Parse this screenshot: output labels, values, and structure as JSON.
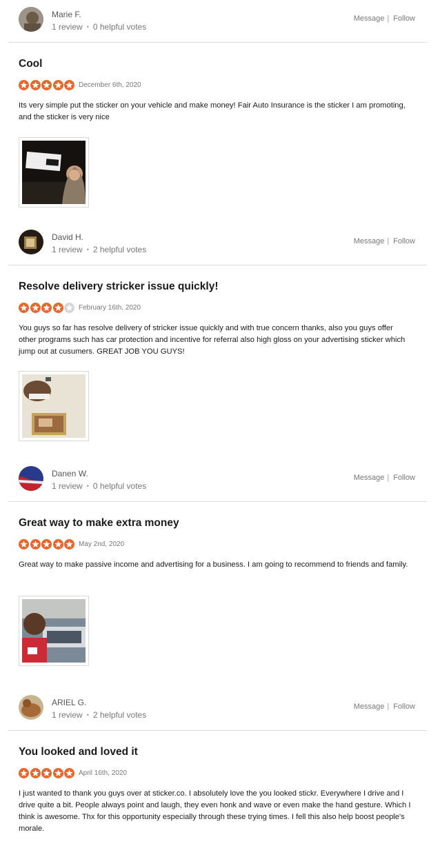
{
  "colors": {
    "star_on": "#e8662a",
    "star_off": "#d6d6d6"
  },
  "reviews": [
    {
      "user": {
        "name": "Marie F.",
        "reviews": "1 review",
        "votes": "0 helpful votes"
      },
      "actions": {
        "message": "Message",
        "separator": "|",
        "follow": "Follow"
      },
      "title": "Cool",
      "rating": 5,
      "date": "December 6th, 2020",
      "text": "Its very simple put the sticker on your vehicle and make money! Fair Auto Insurance is the sticker I am promoting, and the sticker is very nice"
    },
    {
      "user": {
        "name": "David H.",
        "reviews": "1 review",
        "votes": "2 helpful votes"
      },
      "actions": {
        "message": "Message",
        "separator": "|",
        "follow": "Follow"
      },
      "title": "Resolve delivery stricker issue quickly!",
      "rating": 4,
      "date": "February 16th, 2020",
      "text": "You guys so far has resolve delivery of stricker issue quickly and with true concern thanks, also you guys offer other programs such has car protection and incentive for referral also high gloss on your advertising sticker which jump out at cusumers. GREAT JOB YOU GUYS!"
    },
    {
      "user": {
        "name": "Danen W.",
        "reviews": "1 review",
        "votes": "0 helpful votes"
      },
      "actions": {
        "message": "Message",
        "separator": "|",
        "follow": "Follow"
      },
      "title": "Great way to make extra money",
      "rating": 5,
      "date": "May 2nd, 2020",
      "text": "Great way to make passive income and advertising for a business. I am going to recommend to friends and family."
    },
    {
      "user": {
        "name": "ARIEL G.",
        "reviews": "1 review",
        "votes": "2 helpful votes"
      },
      "actions": {
        "message": "Message",
        "separator": "|",
        "follow": "Follow"
      },
      "title": "You looked and loved it",
      "rating": 5,
      "date": "April 16th, 2020",
      "text": "I just wanted to thank you guys over at sticker.co. I absolutely love the you looked stickr. Everywhere I drive and I drive quite a bit. People always point and laugh, they even honk and wave or even make the hand gesture. Which I think is awesome. Thx for this opportunity especially through these trying times. I fell this also help boost people's morale."
    }
  ]
}
